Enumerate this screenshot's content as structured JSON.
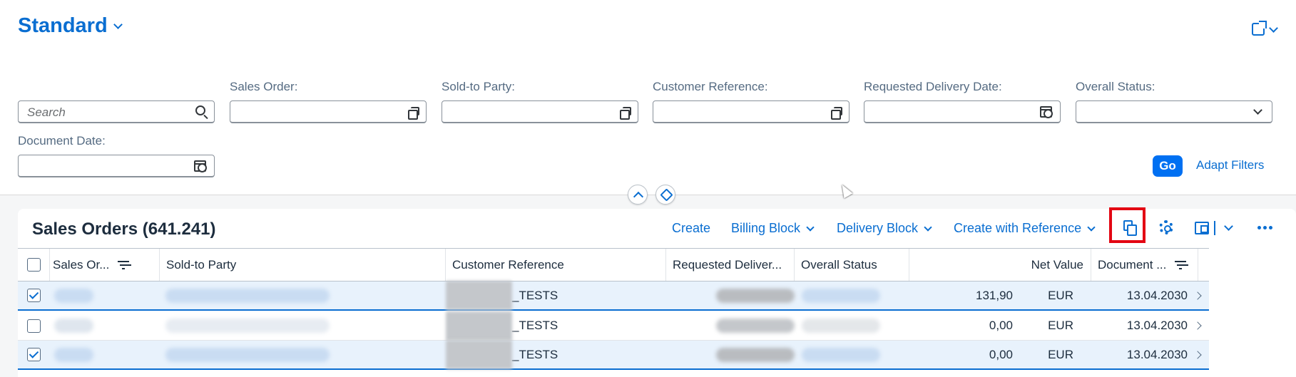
{
  "variant": {
    "title": "Standard"
  },
  "filters": {
    "search_placeholder": "Search",
    "sales_order_label": "Sales Order:",
    "sold_to_party_label": "Sold-to Party:",
    "customer_reference_label": "Customer Reference:",
    "requested_delivery_date_label": "Requested Delivery Date:",
    "overall_status_label": "Overall Status:",
    "document_date_label": "Document Date:",
    "go_label": "Go",
    "adapt_label": "Adapt Filters"
  },
  "table": {
    "title": "Sales Orders (641.241)",
    "toolbar": {
      "create": "Create",
      "billing_block": "Billing Block",
      "delivery_block": "Delivery Block",
      "create_with_reference": "Create with Reference"
    },
    "columns": {
      "sales_order": "Sales Or...",
      "sold_to_party": "Sold-to Party",
      "customer_reference": "Customer Reference",
      "requested_delivery": "Requested Deliver...",
      "overall_status": "Overall Status",
      "net_value": "Net Value",
      "document_date": "Document ..."
    },
    "rows": [
      {
        "selected": true,
        "customer_reference": "_TESTS",
        "net_value": "131,90",
        "currency": "EUR",
        "document_date": "13.04.2030"
      },
      {
        "selected": false,
        "customer_reference": "_TESTS",
        "net_value": "0,00",
        "currency": "EUR",
        "document_date": "13.04.2030"
      },
      {
        "selected": true,
        "customer_reference": "_TESTS",
        "net_value": "0,00",
        "currency": "EUR",
        "document_date": "13.04.2030"
      }
    ]
  },
  "colors": {
    "accent": "#0a6ed1",
    "highlight": "#e30613",
    "go_button": "#0070f2"
  }
}
